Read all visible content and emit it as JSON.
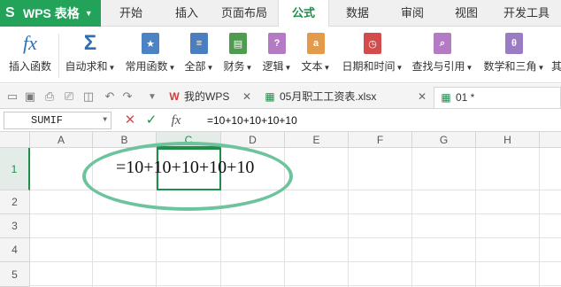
{
  "app": {
    "name": "WPS 表格"
  },
  "menu": {
    "tabs": [
      {
        "label": "开始"
      },
      {
        "label": "插入"
      },
      {
        "label": "页面布局"
      },
      {
        "label": "公式"
      },
      {
        "label": "数据"
      },
      {
        "label": "审阅"
      },
      {
        "label": "视图"
      },
      {
        "label": "开发工具"
      }
    ],
    "active": "公式"
  },
  "ribbon": {
    "buttons": [
      {
        "label": "插入函数",
        "icon": "fx-icon"
      },
      {
        "label": "自动求和",
        "icon": "sigma-icon",
        "dropdown": true
      },
      {
        "label": "常用函数",
        "icon": "star-book-icon",
        "dropdown": true
      },
      {
        "label": "全部",
        "icon": "list-book-icon",
        "dropdown": true
      },
      {
        "label": "财务",
        "icon": "finance-book-icon",
        "dropdown": true
      },
      {
        "label": "逻辑",
        "icon": "question-book-icon",
        "dropdown": true
      },
      {
        "label": "文本",
        "icon": "text-book-icon",
        "dropdown": true
      },
      {
        "label": "日期和时间",
        "icon": "clock-book-icon",
        "dropdown": true
      },
      {
        "label": "查找与引用",
        "icon": "search-book-icon",
        "dropdown": true
      },
      {
        "label": "数学和三角",
        "icon": "theta-book-icon",
        "dropdown": true
      },
      {
        "label": "其"
      }
    ],
    "colors": {
      "sigma": "#2c6fb5",
      "star": "#4b83c4",
      "list": "#4a7ebf",
      "finance": "#4f9b4f",
      "logic": "#b47bc4",
      "text": "#e39a4b",
      "date": "#d24c4c",
      "lookup": "#b47bc4",
      "math": "#9b7cc4"
    }
  },
  "docbar": {
    "tabs": [
      {
        "label": "我的WPS",
        "icon": "wps-logo-icon",
        "closable": true
      },
      {
        "label": "05月职工工资表.xlsx",
        "icon": "spreadsheet-icon",
        "closable": true
      },
      {
        "label": "01 *",
        "icon": "spreadsheet-icon",
        "active": true
      }
    ]
  },
  "formula_bar": {
    "name_box": "SUMIF",
    "cancel": "✕",
    "confirm": "✓",
    "fx": "fx",
    "content": "=10+10+10+10+10"
  },
  "grid": {
    "columns": [
      "A",
      "B",
      "C",
      "D",
      "E",
      "F",
      "G",
      "H"
    ],
    "rows": [
      "1",
      "2",
      "3",
      "4",
      "5"
    ],
    "selected_column": "C",
    "selected_row": "1",
    "cell_text": "=10+10+10+10+10",
    "highlight_color": "#6cc39c",
    "accent": "#1f8e4b"
  }
}
